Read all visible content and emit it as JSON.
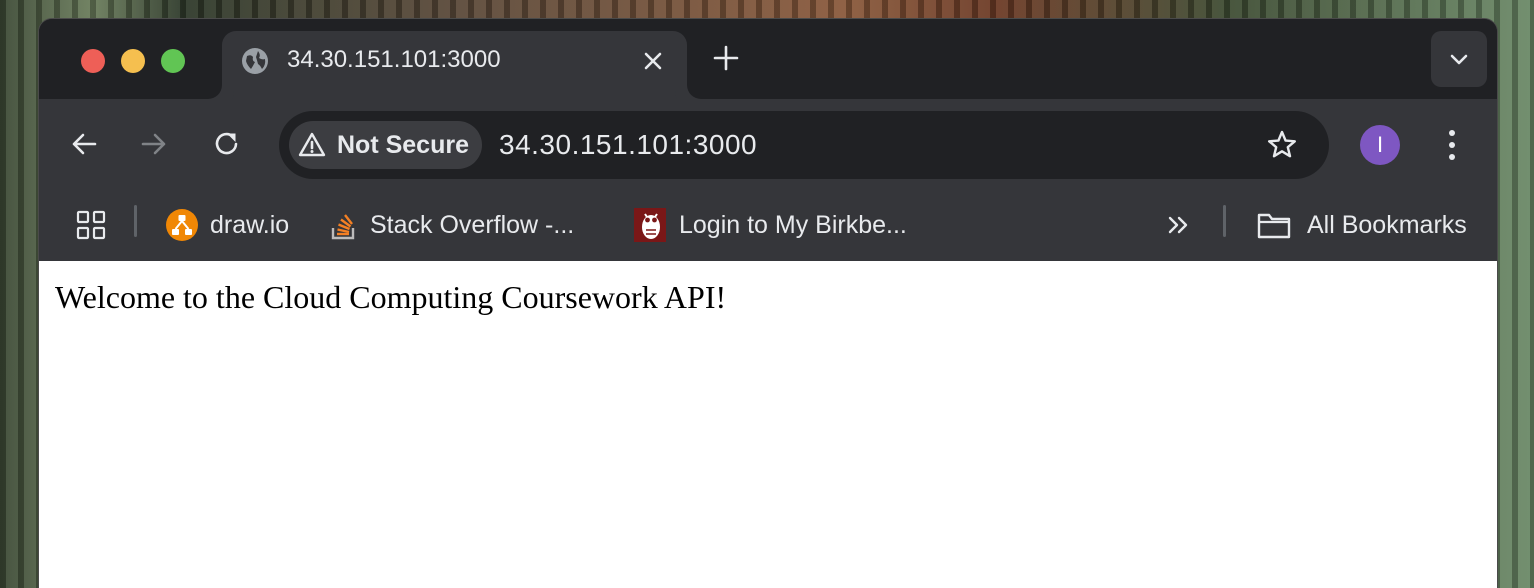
{
  "window": {
    "traffic_lights": [
      "close",
      "minimize",
      "zoom"
    ]
  },
  "tab": {
    "title": "34.30.151.101:3000",
    "icon": "globe-icon"
  },
  "toolbar": {
    "security_label": "Not Secure",
    "url": "34.30.151.101:3000",
    "avatar_letter": "I",
    "avatar_color": "#7e57c2"
  },
  "bookmarks": {
    "items": [
      {
        "label": "draw.io",
        "icon": "drawio-icon"
      },
      {
        "label": "Stack Overflow -...",
        "icon": "stackoverflow-icon"
      },
      {
        "label": "Login to My Birkbe...",
        "icon": "birkbeck-owl-icon"
      }
    ],
    "all_bookmarks_label": "All Bookmarks"
  },
  "page": {
    "body_text": "Welcome to the Cloud Computing Coursework API!"
  }
}
